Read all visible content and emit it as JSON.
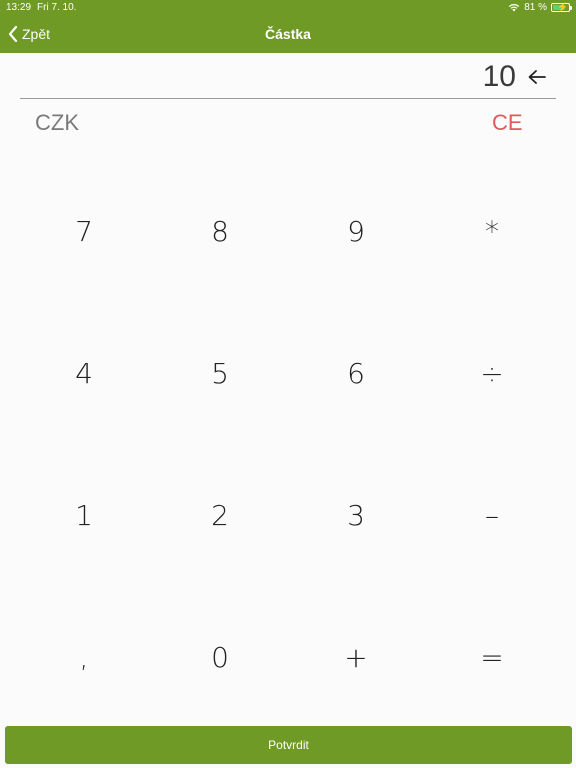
{
  "status_bar": {
    "time": "13:29",
    "date": "Fri 7. 10.",
    "battery_text": "81 %",
    "battery_level": 0.81
  },
  "nav": {
    "back_label": "Zpět",
    "title": "Částka"
  },
  "display": {
    "amount": "10"
  },
  "currency": "CZK",
  "clear_label": "CE",
  "keypad": {
    "keys": [
      "7",
      "8",
      "9",
      "*",
      "4",
      "5",
      "6",
      "÷",
      "1",
      "2",
      "3",
      "–",
      ",",
      "0",
      "+",
      "="
    ]
  },
  "confirm_label": "Potvrdit",
  "colors": {
    "accent": "#709a26",
    "clear": "#e05a5a",
    "battery": "#5fd36b"
  }
}
